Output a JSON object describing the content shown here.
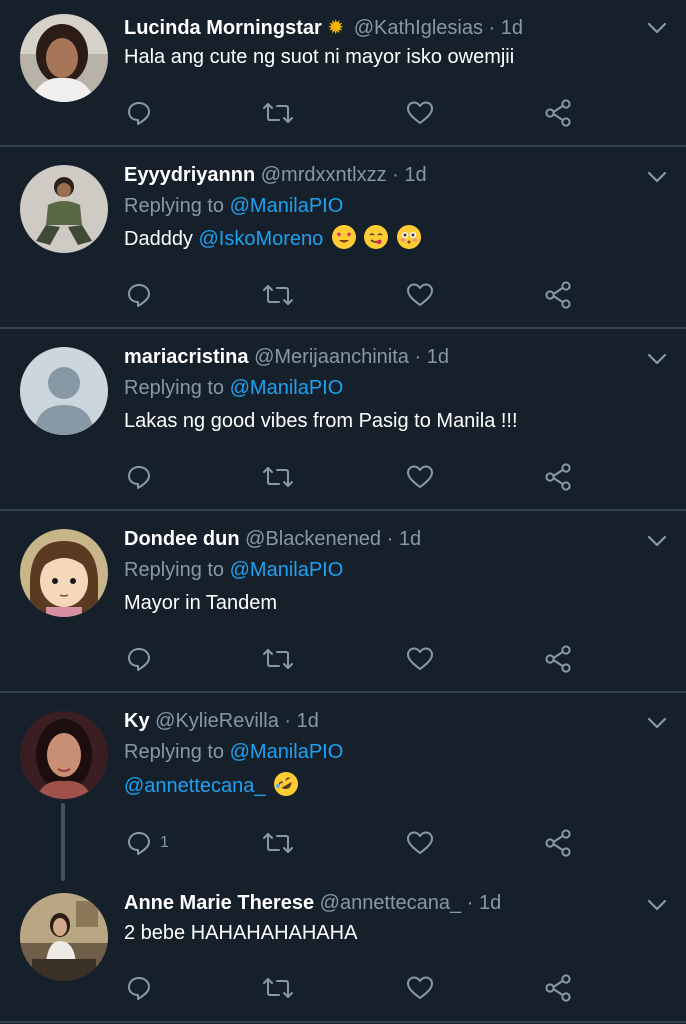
{
  "colors": {
    "background": "#15202b",
    "divider": "#38444d",
    "name": "#ffffff",
    "secondary": "#8899a6",
    "link": "#1da1f2"
  },
  "reply_prefix": "Replying to",
  "tweets": [
    {
      "name": "Lucinda Morningstar",
      "badge_icon": "sun-emoji",
      "handle": "@KathIglesias",
      "dot": "·",
      "time": "1d",
      "text": "Hala ang cute ng suot ni mayor isko owemjii"
    },
    {
      "name": "Eyyydriyannn",
      "handle": "@mrdxxntlxzz",
      "dot": "·",
      "time": "1d",
      "replying_to": "@ManilaPIO",
      "mention": "@IskoMoreno",
      "text": "Dadddy",
      "emojis": [
        "heart-eyes-emoji",
        "yum-emoji",
        "flushed-emoji"
      ]
    },
    {
      "name": "mariacristina",
      "handle": "@Merijaanchinita",
      "dot": "·",
      "time": "1d",
      "replying_to": "@ManilaPIO",
      "text": "Lakas ng good vibes from Pasig to Manila !!!"
    },
    {
      "name": "Dondee dun",
      "handle": "@Blackenened",
      "dot": "·",
      "time": "1d",
      "replying_to": "@ManilaPIO",
      "text": "Mayor in Tandem"
    },
    {
      "name": "Ky",
      "handle": "@KylieRevilla",
      "dot": "·",
      "time": "1d",
      "replying_to": "@ManilaPIO",
      "mention": "@annettecana_",
      "emojis": [
        "rofl-emoji"
      ],
      "reply_count": "1"
    },
    {
      "name": "Anne Marie Therese",
      "handle": "@annettecana_",
      "dot": "·",
      "time": "1d",
      "text": "2 bebe HAHAHAHAHAHA"
    }
  ],
  "icons": {
    "reply": "reply-icon",
    "retweet": "retweet-icon",
    "like": "like-icon",
    "share": "share-icon",
    "caret": "chevron-down-icon"
  }
}
